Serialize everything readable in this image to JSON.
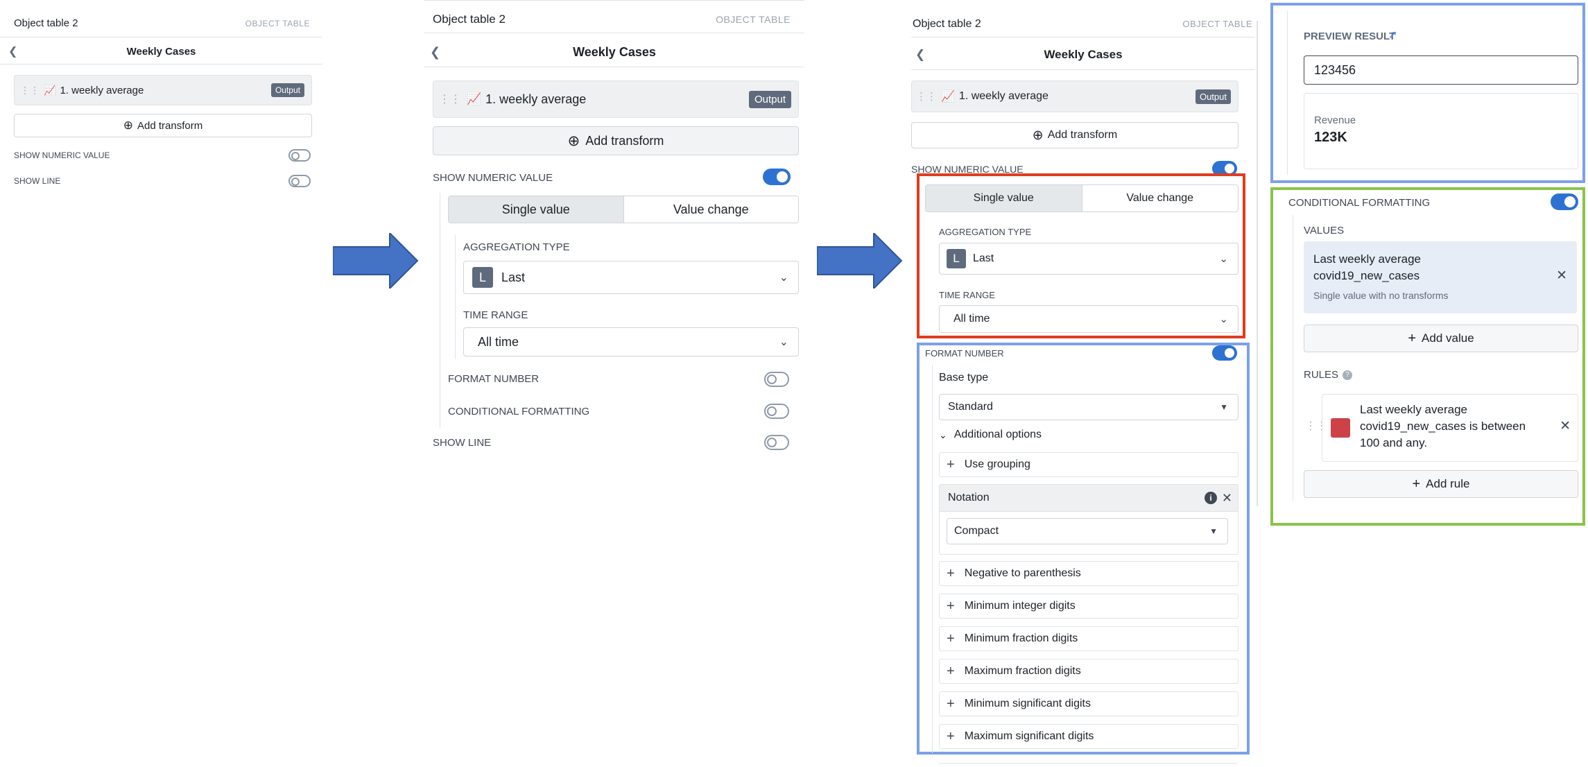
{
  "header": {
    "title": "Object table 2",
    "kind": "OBJECT TABLE"
  },
  "subheader": {
    "back_icon": "chevron-left-icon",
    "title": "Weekly Cases"
  },
  "metric": {
    "name": "1. weekly average",
    "badge": "Output",
    "grip_icon": "drag-handle-icon",
    "chart_icon": "chart-icon"
  },
  "add_transform": "Add transform",
  "show_numeric_value": "SHOW NUMERIC VALUE",
  "show_line": "SHOW LINE",
  "segments": {
    "single": "Single value",
    "change": "Value change"
  },
  "aggregation": {
    "label": "AGGREGATION TYPE",
    "letter": "L",
    "value": "Last"
  },
  "time_range": {
    "label": "TIME RANGE",
    "value": "All time"
  },
  "format_number": "FORMAT NUMBER",
  "conditional_formatting": "CONDITIONAL FORMATTING",
  "format": {
    "base_type_label": "Base type",
    "base_type": "Standard",
    "additional_options": "Additional options",
    "use_grouping": "Use grouping",
    "notation_label": "Notation",
    "notation": "Compact",
    "options": [
      "Negative to parenthesis",
      "Minimum integer digits",
      "Minimum fraction digits",
      "Maximum fraction digits",
      "Minimum significant digits",
      "Maximum significant digits"
    ]
  },
  "preview": {
    "label": "PREVIEW RESULT",
    "input": "123456",
    "card_label": "Revenue",
    "card_value": "123K"
  },
  "cf": {
    "title": "CONDITIONAL FORMATTING",
    "values_label": "VALUES",
    "value_line1": "Last weekly average",
    "value_line2": "covid19_new_cases",
    "value_sub": "Single value with no transforms",
    "add_value": "Add value",
    "rules_label": "RULES",
    "rule_line1": "Last weekly average",
    "rule_line2": "covid19_new_cases is between",
    "rule_line3": "100 and any.",
    "rule_color": "#cd4246",
    "add_rule": "Add rule"
  },
  "colors": {
    "arrow": "#4472c4",
    "highlight_red": "#e03c1f",
    "highlight_blue": "#7da0e8",
    "highlight_green": "#8bc34a",
    "toggle_on": "#2d72d2"
  }
}
